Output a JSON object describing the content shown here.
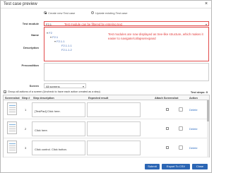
{
  "dialog": {
    "title": "Test case preview",
    "close_glyph": "×"
  },
  "mode": {
    "create_label": "Create new Test case",
    "update_label": "Update existing Test case",
    "selected": "create"
  },
  "form": {
    "test_module_label": "Test module",
    "test_module_value": "F2.1",
    "test_module_hint": "Test module can be filtered by entering text",
    "name_label": "Name",
    "description_label": "Description",
    "precondition_label": "Precondition",
    "screen_label": "Screen",
    "screen_value": "All screens"
  },
  "tree": {
    "items": [
      {
        "label": "F2"
      },
      {
        "label": "F2.1"
      },
      {
        "label": "F2.1.1"
      },
      {
        "label": "F2.1.1.1"
      },
      {
        "label": "F2.1.1.2"
      }
    ],
    "note": "Test modules are now displayed as tree-like structure, which makes it easier to navigate/collapse/expand"
  },
  "group_actions": {
    "label": "Group all actions of a screen (Uncheck to have each action created as a step)",
    "checked": true
  },
  "steps": {
    "count_label": "Test steps: 9",
    "headers": {
      "screenshot": "Screenshot",
      "step": "Step #",
      "description": "Step description",
      "expected": "Expected result",
      "attach": "Attach Screenshot",
      "action": "Action"
    },
    "rows": [
      {
        "step": "1",
        "description": "[TestPad] Click here.",
        "delete": "Delete"
      },
      {
        "step": "2",
        "description": "Click here.",
        "delete": "Delete"
      },
      {
        "step": "3",
        "description": "Click control. Click button.",
        "delete": "Delete"
      }
    ]
  },
  "buttons": {
    "submit": "Submit",
    "export": "Export To CSV",
    "close": "Close"
  },
  "colors": {
    "primary_button": "#2c66b4",
    "highlight": "#e23b3b",
    "link": "#2d6cc0"
  }
}
